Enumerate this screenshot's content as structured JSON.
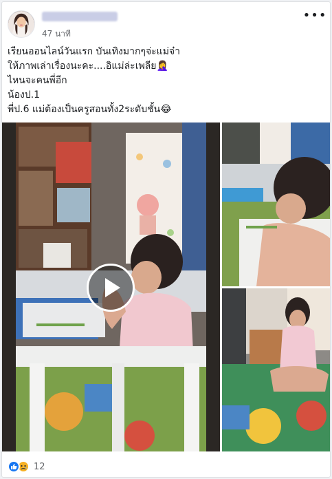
{
  "post": {
    "author_name": "",
    "timestamp": "47 นาที",
    "more_label": "•••",
    "text_lines": [
      "เรียนออนไลน์วันแรก บันเทิงมากๆจ่ะแม่จ๋า",
      "ให้ภาพเล่าเรื่องนะคะ....อิแม่ล่ะเพลีย🤦‍♀️",
      "ไหนจะคนพี่อีก",
      "น้องป.1",
      "พี่ป.6 แม่ต้องเป็นครูสอนทั้ง2ระดับชั้น😂"
    ]
  },
  "media": {
    "main": {
      "type": "video",
      "play_icon": "play-icon"
    },
    "thumbnails": [
      "photo",
      "photo"
    ]
  },
  "reactions": {
    "icons": [
      "like-icon",
      "sad-icon"
    ],
    "count": "12",
    "colors": {
      "like": "#1877f2",
      "sad": "#f7b125"
    }
  },
  "theme": {
    "background": "#f0f2f5",
    "card": "#ffffff",
    "muted_text": "#65676b"
  }
}
